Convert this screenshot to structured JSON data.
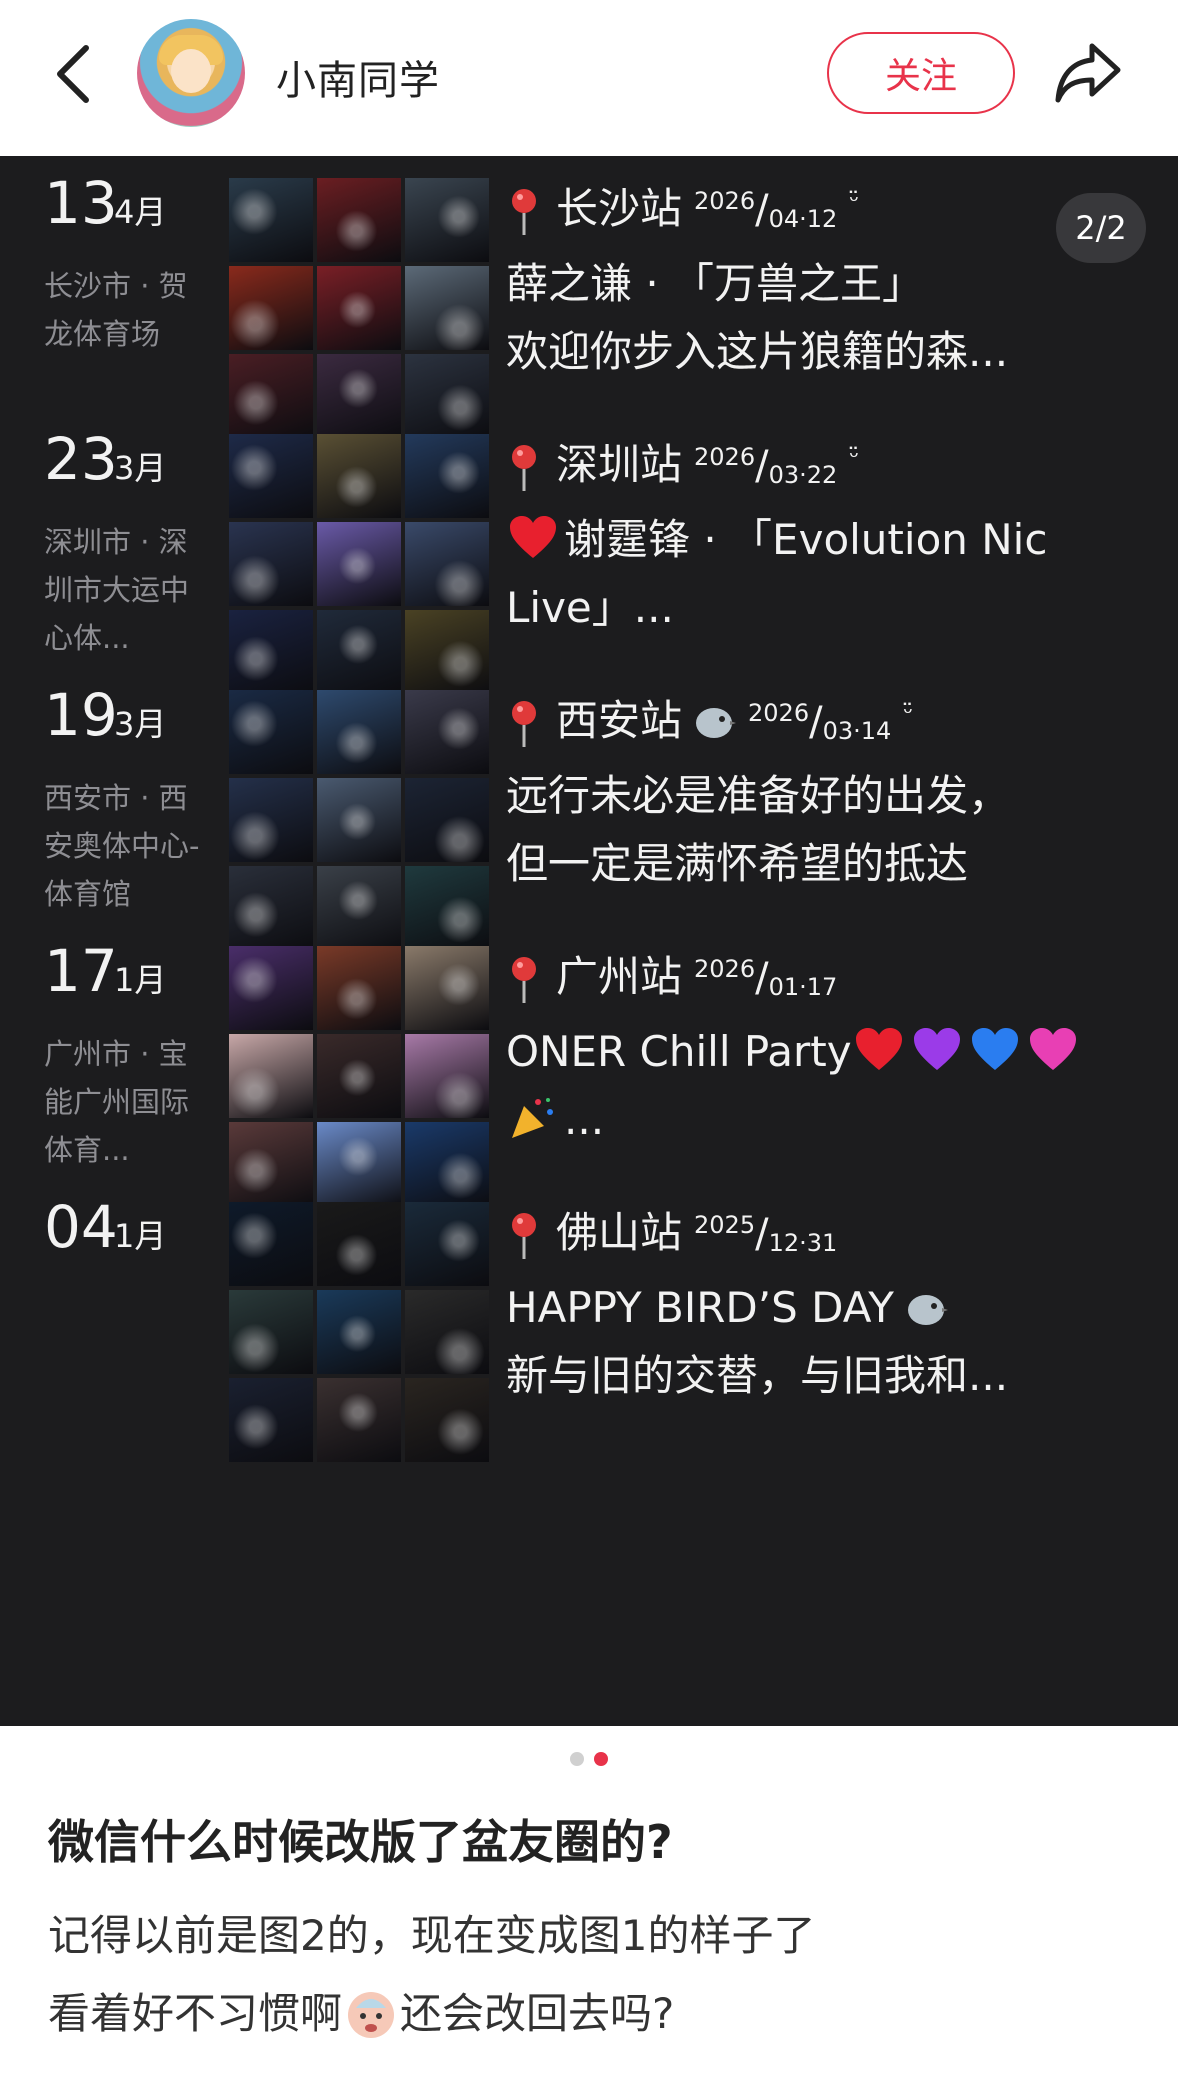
{
  "header": {
    "username": "小南同学",
    "follow_label": "关注"
  },
  "carousel": {
    "indicator": "2/2",
    "entries": [
      {
        "day": "13",
        "month": "4月",
        "place": "长沙市 · 贺龙体育场",
        "station": "长沙站",
        "year": "2026",
        "date": "04·12",
        "smile": "ᵕ̈",
        "body": [
          "薛之谦 · 「万兽之王」",
          "欢迎你步入这片狼籍的森..."
        ]
      },
      {
        "day": "23",
        "month": "3月",
        "place": "深圳市 · 深圳市大运中心体...",
        "station": "深圳站",
        "year": "2026",
        "date": "03·22",
        "smile": "ᵕ̈",
        "body": [
          "谢霆锋 · 「Evolution Nic",
          "Live」..."
        ]
      },
      {
        "day": "19",
        "month": "3月",
        "place": "西安市 · 西安奥体中心-体育馆",
        "station": "西安站",
        "year": "2026",
        "date": "03·14",
        "smile": "ᵕ̈",
        "body": [
          "远行未必是准备好的出发，",
          "但一定是满怀希望的抵达"
        ]
      },
      {
        "day": "17",
        "month": "1月",
        "place": "广州市 · 宝能广州国际体育...",
        "station": "广州站",
        "year": "2026",
        "date": "01·17",
        "smile": "",
        "body": [
          "ONER Chill Party",
          "..."
        ]
      },
      {
        "day": "04",
        "month": "1月",
        "place": "",
        "station": "佛山站",
        "year": "2025",
        "date": "12·31",
        "smile": "",
        "body": [
          "HAPPY BIRD’S DAY",
          "新与旧的交替，与旧我和..."
        ]
      }
    ]
  },
  "post": {
    "title": "微信什么时候改版了盆友圈的?",
    "line1": "记得以前是图2的，现在变成图1的样子了",
    "line2_a": "看着好不习惯啊",
    "line2_b": "还会改回去吗?"
  },
  "icons": {
    "back": "chevron-left-icon",
    "share": "share-arrow-icon",
    "pin": "pushpin-icon",
    "heart": "heart-icon"
  },
  "colors": {
    "accent": "#e8334a",
    "carousel_bg": "#1c1c1e"
  }
}
